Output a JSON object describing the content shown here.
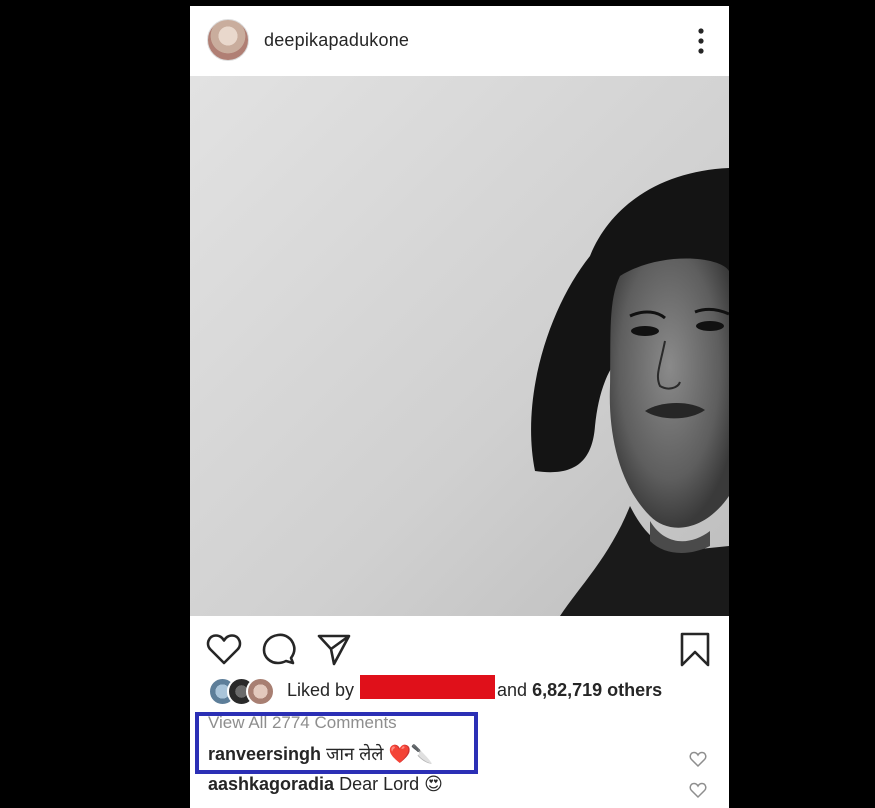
{
  "post": {
    "username": "deepikapadukone",
    "liked_by_prefix": "Liked by",
    "liked_by_suffix_pre": "and",
    "likes_count": "6,82,719 others",
    "view_all_comments": "View All 2774 Comments",
    "comments": [
      {
        "user": "ranveersingh",
        "text": "जान लेले ❤️🔪"
      },
      {
        "user": "aashkagoradia",
        "text": "Dear Lord 😍"
      }
    ]
  },
  "colors": {
    "highlight_box": "#2b2fb5",
    "redaction": "#e0101a"
  },
  "icons": [
    "heart-icon",
    "comment-icon",
    "share-icon",
    "bookmark-icon",
    "more-options-icon"
  ]
}
